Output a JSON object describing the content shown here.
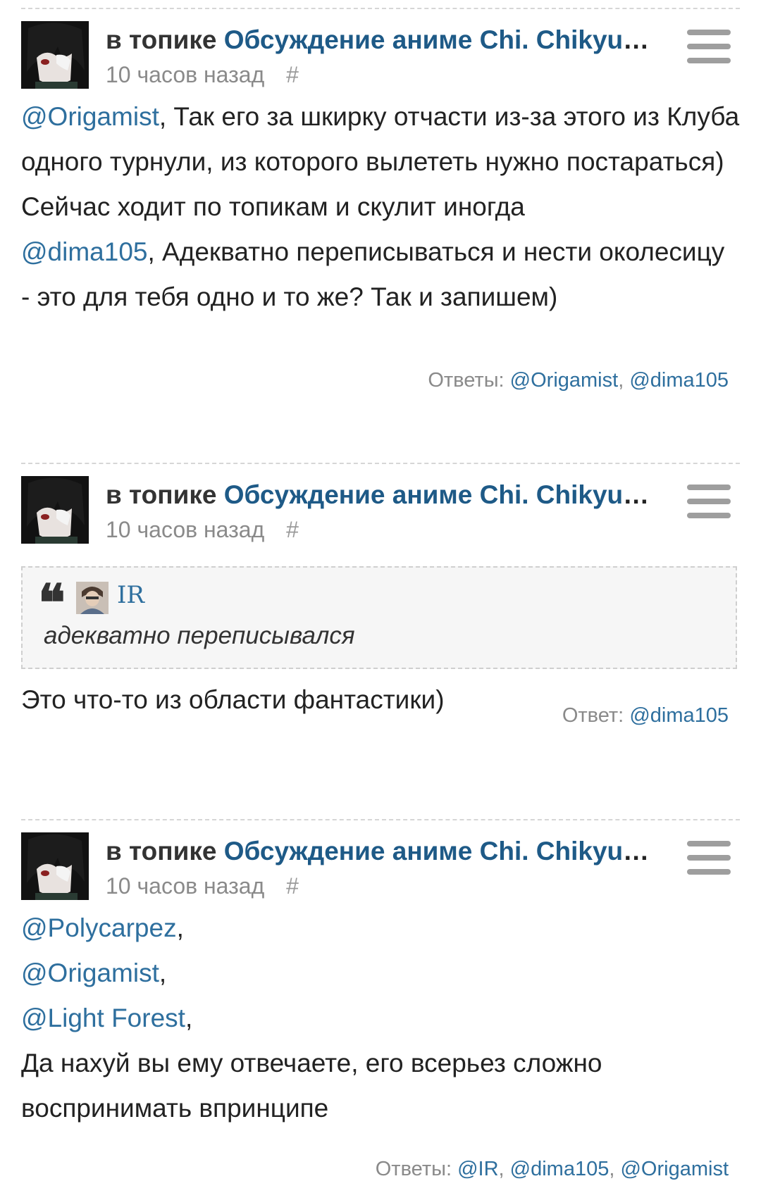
{
  "posts": [
    {
      "prefix": "в топике",
      "topic": "Обсуждение аниме Chi. Chikyuu no Undou ni Tsuite",
      "time": "10 часов назад",
      "hash": "#",
      "body": {
        "l1_mention": "@Origamist",
        "l1_text": ", Так его за шкирку отчасти из-за этого из Клуба одного турнули, из которого вылететь нужно постараться)",
        "l2_text": "Сейчас ходит по топикам и скулит иногда",
        "l3_mention": "@dima105",
        "l3_text": ", Адекватно переписываться и нести околесицу - это для тебя одно и то же? Так и запишем)"
      },
      "replies_label": "Ответы:",
      "replies": [
        "@Origamist",
        "@dima105"
      ]
    },
    {
      "prefix": "в топике",
      "topic": "Обсуждение аниме Chi. Chikyuu no Undou ni Tsuite",
      "time": "10 часов назад",
      "hash": "#",
      "quote": {
        "mark": "❝",
        "user": "IR",
        "text": "адекватно переписывался"
      },
      "body": {
        "text": "Это что-то из области фантастики)"
      },
      "replies_label": "Ответ:",
      "replies": [
        "@dima105"
      ]
    },
    {
      "prefix": "в топике",
      "topic": "Обсуждение аниме Chi. Chikyuu no Undou ni Tsuite",
      "time": "10 часов назад",
      "hash": "#",
      "body": {
        "m1": "@Polycarpez",
        "m2": "@Origamist",
        "m3": "@Light Forest",
        "comma": ",",
        "text": "Да нахуй вы ему отвечаете, его всерьез сложно воспринимать впринципе"
      },
      "replies_label": "Ответы:",
      "replies": [
        "@IR",
        "@dima105",
        "@Origamist"
      ]
    }
  ]
}
